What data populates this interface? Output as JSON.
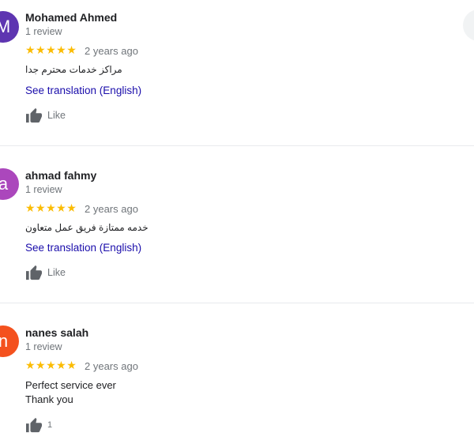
{
  "reviews": [
    {
      "avatar_letter": "M",
      "avatar_color": "#5e35b1",
      "name": "Mohamed Ahmed",
      "review_count": "1 review",
      "stars": "★★★★★",
      "rating": 5,
      "date": "2 years ago",
      "text": "مراكز خدمات محترم جدا",
      "translation_link": "See translation (English)",
      "like_label": "Like"
    },
    {
      "avatar_letter": "a",
      "avatar_color": "#ab47bc",
      "name": "ahmad fahmy",
      "review_count": "1 review",
      "stars": "★★★★★",
      "rating": 5,
      "date": "2 years ago",
      "text": "خدمه ممتازة فريق عمل متعاون",
      "translation_link": "See translation (English)",
      "like_label": "Like"
    },
    {
      "avatar_letter": "n",
      "avatar_color": "#f4511e",
      "name": "nanes salah",
      "review_count": "1 review",
      "stars": "★★★★★",
      "rating": 5,
      "date": "2 years ago",
      "text_line1": "Perfect service ever",
      "text_line2": "Thank you",
      "like_count": "1"
    }
  ],
  "colors": {
    "star": "#fbbc04",
    "link": "#1a0dab",
    "secondary_text": "#70757a",
    "thumb": "#5f6368"
  },
  "icons": {
    "like": "thumbs-up-icon"
  }
}
